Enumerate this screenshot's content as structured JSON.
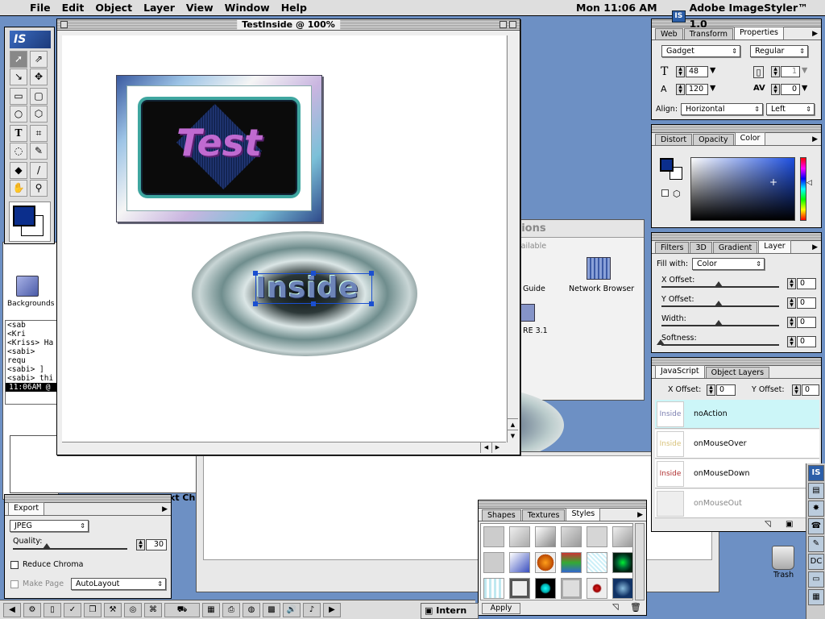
{
  "menubar": {
    "items": [
      "File",
      "Edit",
      "Object",
      "Layer",
      "View",
      "Window",
      "Help"
    ],
    "clock": "Mon 11:06 AM",
    "app_name": "Adobe ImageStyler™ 1.0",
    "app_icon_text": "IS"
  },
  "toolbox": {
    "logo": "IS"
  },
  "document": {
    "title": "TestInside @ 100%",
    "text_test": "Test",
    "text_inside": "Inside"
  },
  "background_windows": {
    "dialog_title": "tions",
    "dialog_sub": "vailable",
    "guide_label": "Guide",
    "network_label": "Network Browser",
    "re_label": "RE 3.1",
    "backgrounds_label": "Backgrounds",
    "chat_lines": [
      "<sab",
      "<Kri",
      "<Kriss> Ha",
      "<sabi> requ",
      "<sabi> ]",
      "<sabi> thi"
    ],
    "chat_status": "11:06AM @",
    "chart_fragment": "kt Ch",
    "taskbar_fragment": "Intern"
  },
  "props_panel": {
    "tabs": [
      "Web",
      "Transform",
      "Properties"
    ],
    "font": "Gadget",
    "style": "Regular",
    "size": "48",
    "leading": "120",
    "tracking_val": "1",
    "kern_val": "0",
    "align_label": "Align:",
    "align_value": "Horizontal",
    "justify": "Left"
  },
  "color_panel": {
    "tabs": [
      "Distort",
      "Opacity",
      "Color"
    ]
  },
  "layer_panel": {
    "tabs": [
      "Filters",
      "3D",
      "Gradient",
      "Layer"
    ],
    "fill_label": "Fill with:",
    "fill_value": "Color",
    "rows": [
      {
        "label": "X Offset:",
        "value": "0"
      },
      {
        "label": "Y Offset:",
        "value": "0"
      },
      {
        "label": "Width:",
        "value": "0"
      },
      {
        "label": "Softness:",
        "value": "0"
      }
    ]
  },
  "js_panel": {
    "tabs": [
      "JavaScript",
      "Object Layers"
    ],
    "x_label": "X Offset:",
    "x_value": "0",
    "y_label": "Y Offset:",
    "y_value": "0",
    "states": [
      {
        "thumb": "Inside",
        "name": "noAction",
        "color": "#7b7fb0"
      },
      {
        "thumb": "Inside",
        "name": "onMouseOver",
        "color": "#d8c27a"
      },
      {
        "thumb": "Inside",
        "name": "onMouseDown",
        "color": "#b03030"
      },
      {
        "thumb": "",
        "name": "onMouseOut",
        "color": "#cccccc"
      }
    ]
  },
  "export_panel": {
    "tabs": [
      "Export"
    ],
    "format": "JPEG",
    "quality_label": "Quality:",
    "quality_value": "30",
    "reduce_chroma": "Reduce Chroma",
    "make_page": "Make Page",
    "layout": "AutoLayout"
  },
  "styles_panel": {
    "tabs": [
      "Shapes",
      "Textures",
      "Styles"
    ],
    "apply": "Apply"
  },
  "trash_label": "Trash",
  "colors": {
    "desktop": "#6d90c4",
    "accent": "#0b2e8c"
  }
}
